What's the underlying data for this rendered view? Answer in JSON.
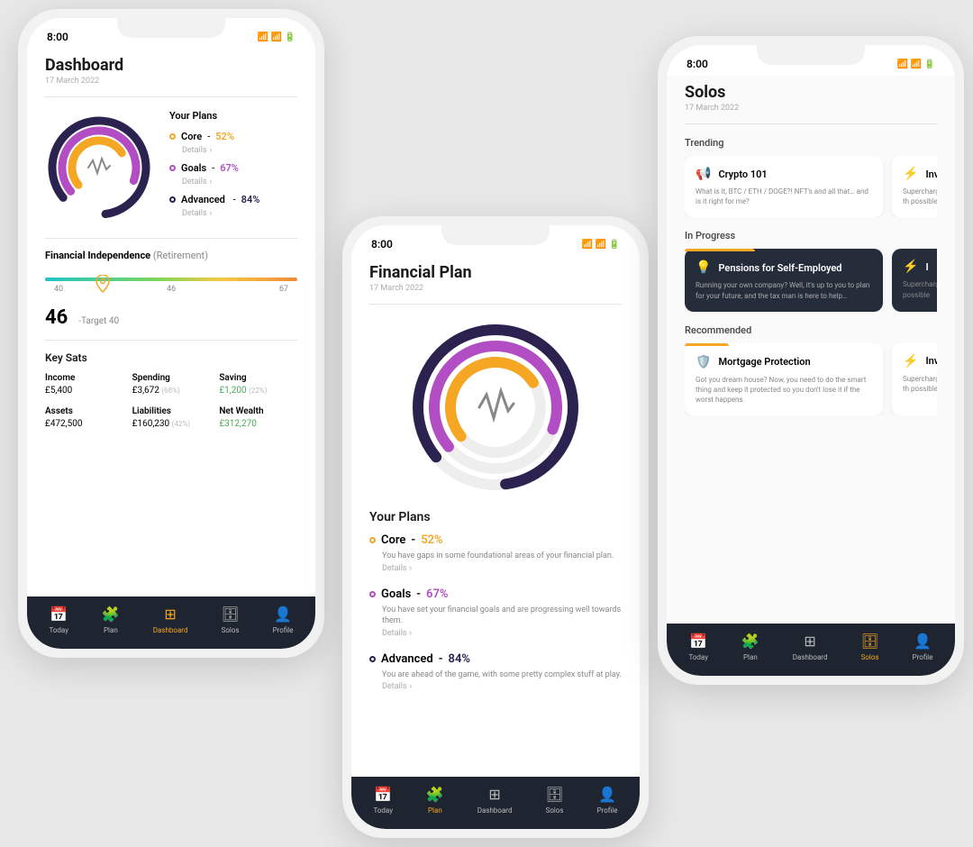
{
  "status": {
    "time": "8:00"
  },
  "phone1": {
    "title": "Dashboard",
    "date": "17 March 2022",
    "plans_header": "Your Plans",
    "plans": [
      {
        "name": "Core",
        "pct": "52%",
        "details": "Details"
      },
      {
        "name": "Goals",
        "pct": "67%",
        "details": "Details"
      },
      {
        "name": "Advanced",
        "pct": "84%",
        "details": "Details"
      }
    ],
    "fi": {
      "title": "Financial Independence",
      "retire": "(Retirement)",
      "marks": [
        "40",
        "46",
        "67"
      ],
      "value": "46",
      "target": "-Target 40"
    },
    "keysats": {
      "title": "Key Sats"
    },
    "stats": [
      {
        "label": "Income",
        "value": "£5,400"
      },
      {
        "label": "Spending",
        "value": "£3,672",
        "sub": "(68%)"
      },
      {
        "label": "Saving",
        "value": "£1,200",
        "sub": "(22%)",
        "green": true
      },
      {
        "label": "Assets",
        "value": "£472,500"
      },
      {
        "label": "Liabilities",
        "value": "£160,230",
        "sub": "(42%)"
      },
      {
        "label": "Net Wealth",
        "value": "£312,270",
        "green": true
      }
    ]
  },
  "phone2": {
    "title": "Financial Plan",
    "date": "17 March 2022",
    "plans_header": "Your Plans",
    "plans": [
      {
        "name": "Core",
        "pct": "52%",
        "desc": "You have gaps in some foundational areas of your financial plan.",
        "details": "Details"
      },
      {
        "name": "Goals",
        "pct": "67%",
        "desc": "You have set your financial goals and are progressing well towards them.",
        "details": "Details"
      },
      {
        "name": "Advanced",
        "pct": "84%",
        "desc": "You are ahead of the game, with some pretty complex stuff at play.",
        "details": "Details"
      }
    ]
  },
  "phone3": {
    "title": "Solos",
    "date": "17 March 2022",
    "sections": {
      "trending": "Trending",
      "progress": "In Progress",
      "recommended": "Recommended"
    },
    "trending": [
      {
        "title": "Crypto 101",
        "desc": "What is it, BTC / ETH / DOGE?! NFT's and all that… and is it right for me?"
      },
      {
        "title": "Inv",
        "desc": "Supercharge th possible"
      }
    ],
    "progress": [
      {
        "title": "Pensions for Self-Employed",
        "desc": "Running your own company? Well, it's up to you to plan for your future, and the tax man is here to help…"
      },
      {
        "title": "I",
        "desc": "Supercharge possible"
      }
    ],
    "recommended": [
      {
        "title": "Mortgage Protection",
        "desc": "Got you dream house? Now, you need to do the smart thing and keep it protected so you don't lose it if the worst happens."
      },
      {
        "title": "Inv",
        "desc": "Supercharge th possible"
      }
    ]
  },
  "tabs": [
    {
      "label": "Today"
    },
    {
      "label": "Plan"
    },
    {
      "label": "Dashboard"
    },
    {
      "label": "Solos"
    },
    {
      "label": "Profile"
    }
  ],
  "chart_data": {
    "type": "pie",
    "title": "Your Plans",
    "series": [
      {
        "name": "Core",
        "values": [
          52
        ],
        "color": "#f5a623"
      },
      {
        "name": "Goals",
        "values": [
          67
        ],
        "color": "#b24dc4"
      },
      {
        "name": "Advanced",
        "values": [
          84
        ],
        "color": "#2b2250"
      }
    ],
    "ylim": [
      0,
      100
    ]
  }
}
